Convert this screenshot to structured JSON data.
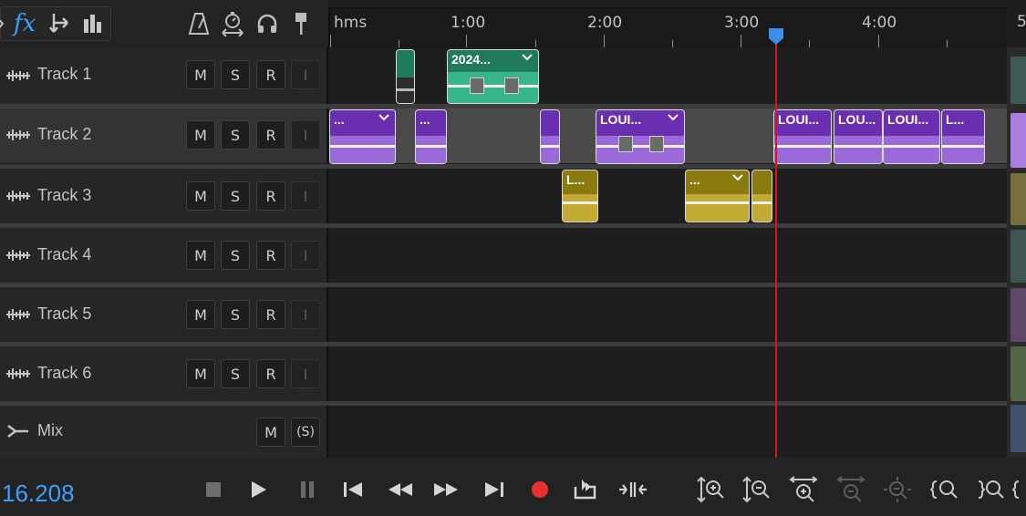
{
  "colors": {
    "accent_blue": "#3aa0ff",
    "track2_clip": "#6a2fb0",
    "track1_clip": "#1f7a5e",
    "track3_clip": "#8a7a10",
    "playhead": "#c61d1d",
    "record": "#e8312f"
  },
  "toolbar": {
    "fx_label": "fx",
    "icons": [
      "more-icon",
      "effects-icon",
      "send-icon",
      "meter-icon",
      "metronome-icon",
      "timer-icon",
      "headphones-icon",
      "marker-icon"
    ]
  },
  "ruler": {
    "unit_label": "hms",
    "labels": [
      "1:00",
      "2:00",
      "3:00",
      "4:00",
      "5"
    ]
  },
  "tracks": [
    {
      "name": "Track 1",
      "buttons": [
        "M",
        "S",
        "R",
        "I"
      ]
    },
    {
      "name": "Track 2",
      "buttons": [
        "M",
        "S",
        "R",
        "I"
      ]
    },
    {
      "name": "Track 3",
      "buttons": [
        "M",
        "S",
        "R",
        "I"
      ]
    },
    {
      "name": "Track 4",
      "buttons": [
        "M",
        "S",
        "R",
        "I"
      ]
    },
    {
      "name": "Track 5",
      "buttons": [
        "M",
        "S",
        "R",
        "I"
      ]
    },
    {
      "name": "Track 6",
      "buttons": [
        "M",
        "S",
        "R",
        "I"
      ]
    }
  ],
  "mix": {
    "name": "Mix",
    "buttons": [
      "M",
      "(S)"
    ]
  },
  "clips": {
    "track1": [
      "",
      "2024..."
    ],
    "track2": [
      "...",
      "...",
      "",
      "LOUI...",
      "LOUI...",
      "LOU...",
      "LOUI...",
      "L..."
    ],
    "track3": [
      "L...",
      "...",
      ""
    ]
  },
  "transport": {
    "time": "16.208",
    "buttons": [
      "stop",
      "play",
      "pause",
      "go-to-start",
      "rewind",
      "fast-forward",
      "go-to-end",
      "record",
      "loop",
      "skip-selection"
    ],
    "zoom_buttons": [
      "zoom-in-amplitude",
      "zoom-out-amplitude",
      "zoom-in-time",
      "zoom-out-time",
      "zoom-out-full",
      "zoom-to-in-point",
      "zoom-to-out-point",
      "zoom-selection"
    ]
  }
}
